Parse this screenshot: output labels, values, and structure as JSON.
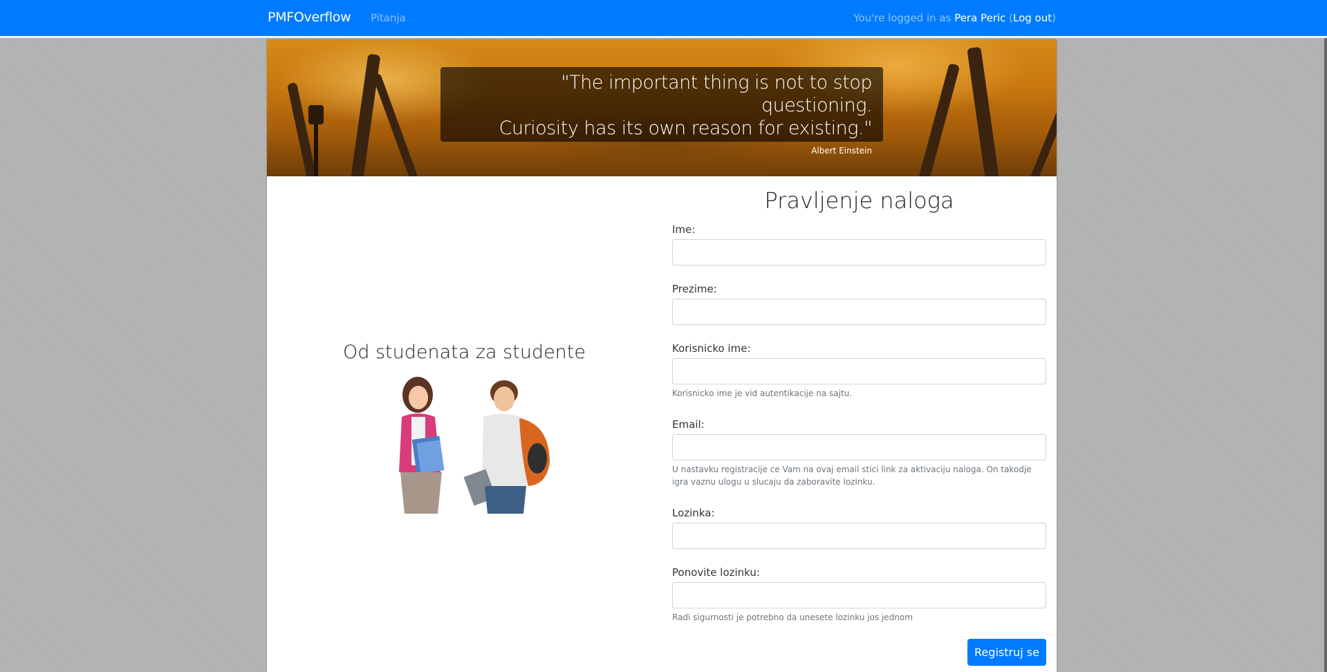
{
  "navbar": {
    "brand": "PMFOverflow",
    "nav_link": "Pitanja",
    "login_prefix": "You're logged in as ",
    "username": "Pera Peric",
    "paren_open": " (",
    "logout": "Log out",
    "paren_close": ")",
    "bg_color": "#007bff"
  },
  "hero": {
    "quote_line1": "\"The important thing is not to stop questioning.",
    "quote_line2": "Curiosity has its own reason for existing.\"",
    "author": "Albert Einstein"
  },
  "left": {
    "title": "Od studenata za studente"
  },
  "form": {
    "title": "Pravljenje naloga",
    "fields": [
      {
        "label": "Ime:",
        "value": "",
        "help": ""
      },
      {
        "label": "Prezime:",
        "value": "",
        "help": ""
      },
      {
        "label": "Korisnicko ime:",
        "value": "",
        "help": "Korisnicko ime je vid autentikacije na sajtu."
      },
      {
        "label": "Email:",
        "value": "",
        "help": "U nastavku registracije ce Vam na ovaj email stici link za aktivaciju naloga. On takodje igra vaznu ulogu u slucaju da zaboravite lozinku."
      },
      {
        "label": "Lozinka:",
        "value": "",
        "help": ""
      },
      {
        "label": "Ponovite lozinku:",
        "value": "",
        "help": "Radi sigurnosti je potrebno da unesete lozinku jos jednom"
      }
    ],
    "submit_label": "Registruj se"
  }
}
